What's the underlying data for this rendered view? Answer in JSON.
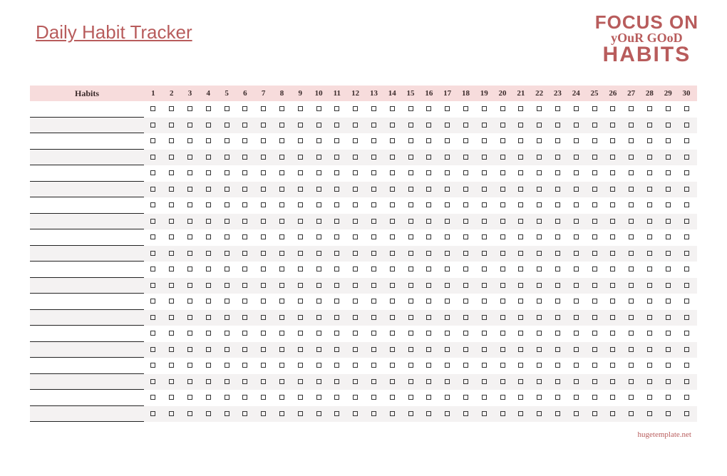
{
  "title": "Daily Habit Tracker",
  "motto": {
    "line1": "FOCUS ON",
    "line2": "yOuR GOoD",
    "line3": "HABITS"
  },
  "habits_header": "Habits",
  "days": [
    "1",
    "2",
    "3",
    "4",
    "5",
    "6",
    "7",
    "8",
    "9",
    "10",
    "11",
    "12",
    "13",
    "14",
    "15",
    "16",
    "17",
    "18",
    "19",
    "20",
    "21",
    "22",
    "23",
    "24",
    "25",
    "26",
    "27",
    "28",
    "29",
    "30"
  ],
  "habit_rows": [
    "",
    "",
    "",
    "",
    "",
    "",
    "",
    "",
    "",
    "",
    "",
    "",
    "",
    "",
    "",
    "",
    "",
    "",
    "",
    ""
  ],
  "footer": "hugetemplate.net"
}
